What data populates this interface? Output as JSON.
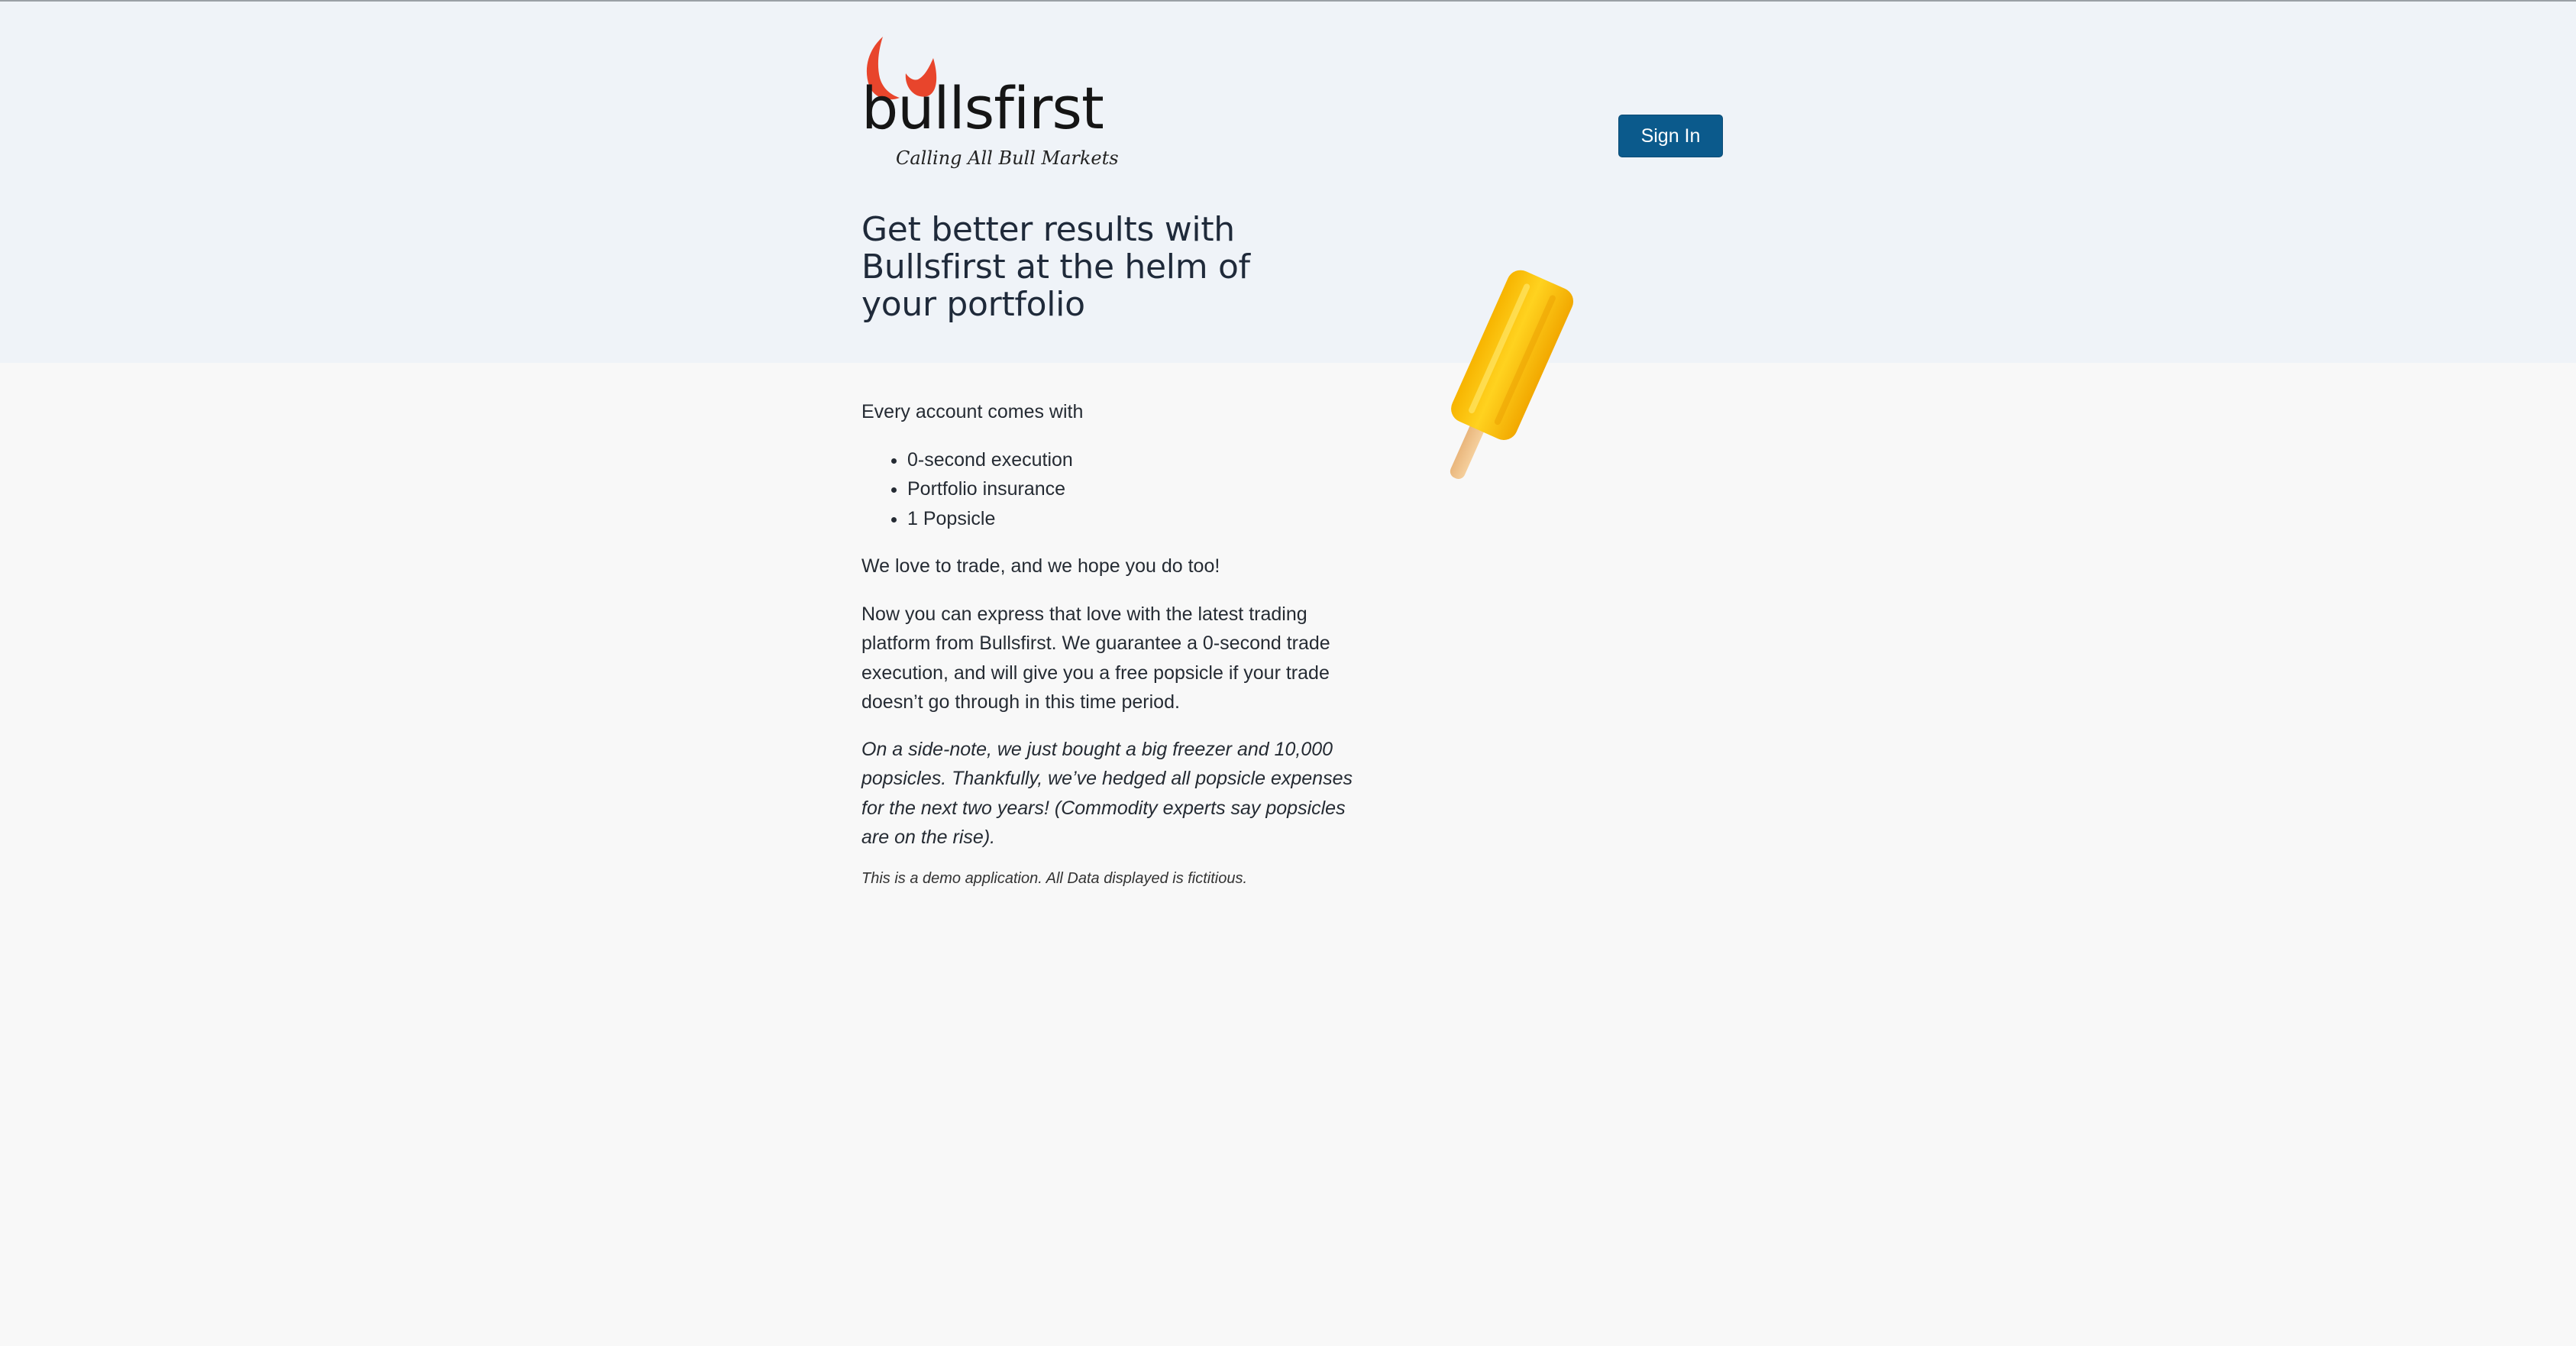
{
  "header": {
    "logo_text": "bullsfirst",
    "tagline": "Calling All Bull Markets",
    "sign_in_label": "Sign In",
    "headline": "Get better results with Bullsfirst at the helm of your portfolio"
  },
  "colors": {
    "accent": "#e8452c",
    "primary_button": "#0b5a8c",
    "hero_background": "#eff3f8",
    "page_background": "#f8f8f8"
  },
  "main": {
    "intro": "Every account comes with",
    "features": [
      "0-second execution",
      "Portfolio insurance",
      "1 Popsicle"
    ],
    "love": "We love to trade, and we hope you do too!",
    "description": "Now you can express that love with the latest trading platform from Bullsfirst. We guarantee a 0-second trade execution, and will give you a free popsicle if your trade doesn’t go through in this time period.",
    "side_note": "On a side-note, we just bought a big freezer and 10,000 popsicles. Thankfully, we’ve hedged all popsicle expenses for the next two years! (Commodity experts say popsicles are on the rise).",
    "disclaimer": "This is a demo application. All Data displayed is fictitious."
  },
  "icons": {
    "logo_mark": "bull-horns-icon",
    "illustration": "popsicle-image"
  }
}
